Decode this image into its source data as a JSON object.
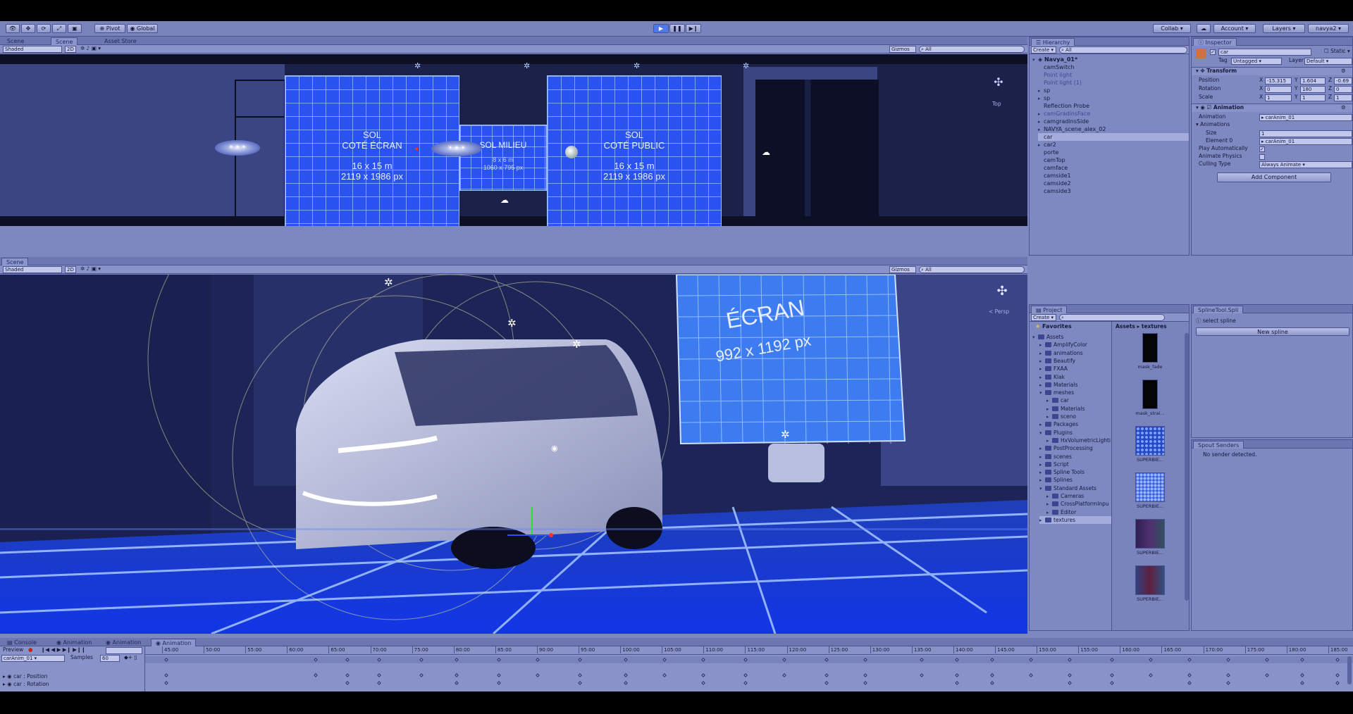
{
  "toolbar": {
    "pivot": "Pivot",
    "global": "Global",
    "collab": "Collab",
    "account": "Account",
    "layers": "Layers",
    "layout": "navya2"
  },
  "top_view": {
    "tabs": [
      "Scene",
      "Scene",
      "Asset Store"
    ],
    "shading": "Shaded",
    "mode_2d": "2D",
    "gizmos": "Gizmos",
    "search_placeholder": "All",
    "gizmo_label": "Top",
    "sol_left": {
      "title": "SOL",
      "subtitle": "COTÉ ÉCRAN",
      "size_m": "16 x 15 m",
      "size_px": "2119 x 1986 px"
    },
    "sol_middle": {
      "title": "SOL MILIEU",
      "size_m": "8 x 6 m",
      "size_px": "1060 x 795 px"
    },
    "sol_right": {
      "title": "SOL",
      "subtitle": "COTÉ PUBLIC",
      "size_m": "16 x 15 m",
      "size_px": "2119 x 1986 px"
    }
  },
  "bottom_view": {
    "tab": "Scene",
    "shading": "Shaded",
    "mode_2d": "2D",
    "gizmos": "Gizmos",
    "search_placeholder": "All",
    "gizmo_label": "< Persp",
    "screen_title": "ÉCRAN",
    "screen_size": "992 x 1192 px"
  },
  "hierarchy": {
    "title": "Hierarchy",
    "create": "Create",
    "search_placeholder": "All",
    "root": "Navya_01*",
    "items": [
      "camSwitch",
      "Point light",
      "Point light (1)",
      "sp",
      "sp",
      "Reflection Probe",
      "camGradinsFace",
      "camgradinsSide",
      "NAVYA_scene_alex_02",
      "car",
      "car2",
      "porte",
      "camTop",
      "camface",
      "camside1",
      "camside2",
      "camside3"
    ]
  },
  "inspector": {
    "title": "Inspector",
    "object_name": "car",
    "static": "Static",
    "tag_label": "Tag",
    "tag_value": "Untagged",
    "layer_label": "Layer",
    "layer_value": "Default",
    "transform": {
      "title": "Transform",
      "position_label": "Position",
      "rotation_label": "Rotation",
      "scale_label": "Scale",
      "position": {
        "x": "-15.315",
        "y": "1.604",
        "z": "-0.69"
      },
      "rotation": {
        "x": "0",
        "y": "180",
        "z": "0"
      },
      "scale": {
        "x": "1",
        "y": "1",
        "z": "1"
      }
    },
    "animation": {
      "title": "Animation",
      "animation_label": "Animation",
      "animation_value": "carAnim_01",
      "animations_label": "Animations",
      "size_label": "Size",
      "size_value": "1",
      "element0_label": "Element 0",
      "element0_value": "carAnim_01",
      "play_auto_label": "Play Automatically",
      "animate_physics_label": "Animate Physics",
      "culling_label": "Culling Type",
      "culling_value": "Always Animate"
    },
    "add_component": "Add Component"
  },
  "project": {
    "title": "Project",
    "create": "Create",
    "favorites": "Favorites",
    "breadcrumb": "Assets ▸ textures",
    "tree": [
      {
        "label": "Assets",
        "depth": 0,
        "open": true
      },
      {
        "label": "AmplifyColor",
        "depth": 1
      },
      {
        "label": "animations",
        "depth": 1
      },
      {
        "label": "Beautify",
        "depth": 1
      },
      {
        "label": "FXAA",
        "depth": 1
      },
      {
        "label": "Klak",
        "depth": 1
      },
      {
        "label": "Materials",
        "depth": 1
      },
      {
        "label": "meshes",
        "depth": 1,
        "open": true
      },
      {
        "label": "car",
        "depth": 2
      },
      {
        "label": "Materials",
        "depth": 2
      },
      {
        "label": "sceno",
        "depth": 2
      },
      {
        "label": "Packages",
        "depth": 1
      },
      {
        "label": "Plugins",
        "depth": 1,
        "open": true
      },
      {
        "label": "HxVolumetricLighti",
        "depth": 2
      },
      {
        "label": "PostProcessing",
        "depth": 1
      },
      {
        "label": "scenes",
        "depth": 1
      },
      {
        "label": "Script",
        "depth": 1
      },
      {
        "label": "Spline Tools",
        "depth": 1
      },
      {
        "label": "Splines",
        "depth": 1
      },
      {
        "label": "Standard Assets",
        "depth": 1,
        "open": true
      },
      {
        "label": "Cameras",
        "depth": 2
      },
      {
        "label": "CrossPlatformInpu",
        "depth": 2
      },
      {
        "label": "Editor",
        "depth": 2
      },
      {
        "label": "textures",
        "depth": 1
      }
    ],
    "assets": [
      "mask_fade",
      "mask_strai...",
      "SUPERBIE...",
      "SUPERBIE...",
      "SUPERBIE...",
      "SUPERBIE..."
    ]
  },
  "spline_tool": {
    "title": "SplineTool.Spli",
    "hint": "select spline",
    "new_spline": "New spline"
  },
  "spout": {
    "title": "Spout Senders",
    "message": "No sender detected."
  },
  "animation_panel": {
    "tabs": [
      "Console",
      "Animation",
      "Animation",
      "Animation"
    ],
    "preview": "Preview",
    "clip": "carAnim_01",
    "samples_label": "Samples",
    "samples_value": "60",
    "ruler": [
      "45:00",
      "50:00",
      "55:00",
      "60:00",
      "65:00",
      "70:00",
      "75:00",
      "80:00",
      "85:00",
      "90:00",
      "95:00",
      "100:00",
      "105:00",
      "110:00",
      "115:00",
      "120:00",
      "125:00",
      "130:00",
      "135:00",
      "140:00",
      "145:00",
      "150:00",
      "155:00",
      "160:00",
      "165:00",
      "170:00",
      "175:00",
      "180:00",
      "185:00"
    ],
    "tracks": [
      "car : Position",
      "car : Rotation"
    ]
  }
}
